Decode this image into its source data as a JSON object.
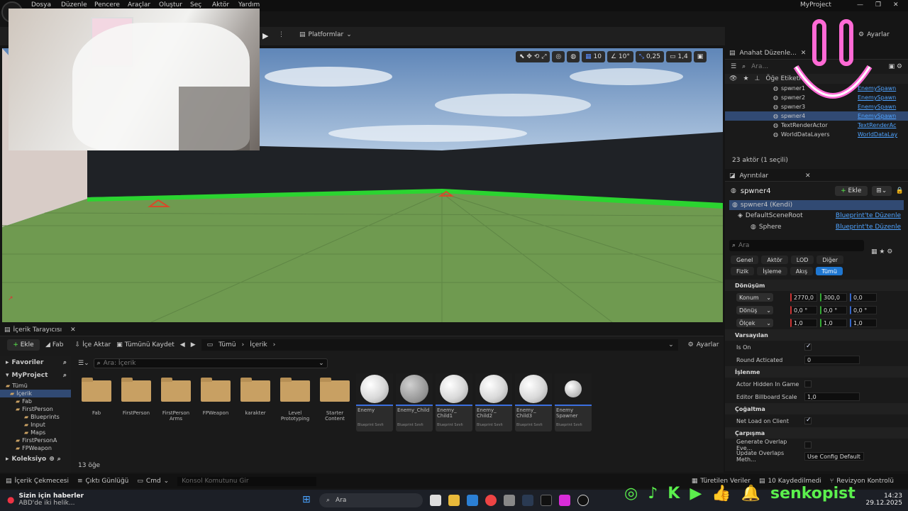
{
  "app": {
    "title": "MyProject"
  },
  "menu": [
    "Dosya",
    "Düzenle",
    "Pencere",
    "Araçlar",
    "Oluştur",
    "Seç",
    "Aktör",
    "Yardım"
  ],
  "toolbar": {
    "platforms": "Platformlar",
    "settings": "Ayarlar"
  },
  "viewport": {
    "grid_snap": "10",
    "rot_snap": "10°",
    "scale_snap": "0,25",
    "cam_speed": "1,4"
  },
  "outliner": {
    "tab": "Anahat Düzenle...",
    "search_placeholder": "Ara...",
    "col_label": "Öğe Etiketi",
    "rows": [
      {
        "name": "spwner1",
        "type": "EnemySpawn"
      },
      {
        "name": "spwner2",
        "type": "EnemySpawn"
      },
      {
        "name": "spwner3",
        "type": "EnemySpawn"
      },
      {
        "name": "spwner4",
        "type": "EnemySpawn"
      },
      {
        "name": "TextRenderActor",
        "type": "TextRenderAc"
      },
      {
        "name": "WorldDataLayers",
        "type": "WorldDataLay"
      }
    ],
    "count": "23 aktör (1 seçili)"
  },
  "details": {
    "tab": "Ayrıntılar",
    "actor": "spwner4",
    "add": "Ekle",
    "self": "spwner4 (Kendi)",
    "root": "DefaultSceneRoot",
    "sphere": "Sphere",
    "edit_bp": "Blueprint'te Düzenle",
    "search_placeholder": "Ara",
    "filters": [
      "Genel",
      "Aktör",
      "LOD",
      "Diğer",
      "Fizik",
      "İşleme",
      "Akış",
      "Tümü"
    ],
    "sec_transform": "Dönüşüm",
    "loc_label": "Konum",
    "rot_label": "Dönüş",
    "scale_label": "Ölçek",
    "loc": [
      "2770,0",
      "300,0",
      "0,0"
    ],
    "rot": [
      "0,0 °",
      "0,0 °",
      "0,0 °"
    ],
    "scale": [
      "1,0",
      "1,0",
      "1,0"
    ],
    "sec_default": "Varsayılan",
    "is_on": "Is On",
    "round": "Round Acticated",
    "round_val": "0",
    "sec_render": "İşlenme",
    "hidden": "Actor Hidden In Game",
    "billboard": "Editor Billboard Scale",
    "billboard_val": "1,0",
    "sec_repl": "Çoğaltma",
    "netload": "Net Load on Client",
    "sec_coll": "Çarpışma",
    "overlap": "Generate Overlap Eve...",
    "update": "Update Overlaps Meth...",
    "update_val": "Use Config Default"
  },
  "content": {
    "tab": "İçerik Tarayıcısı",
    "add": "Ekle",
    "fab": "Fab",
    "import": "İçe Aktar",
    "saveall": "Tümünü Kaydet",
    "crumbs": [
      "Tümü",
      "İçerik"
    ],
    "settings": "Ayarlar",
    "favorites": "Favoriler",
    "project": "MyProject",
    "search_placeholder": "Ara: İçerik",
    "tree": [
      "Tümü",
      "İçerik",
      "Fab",
      "FirstPerson",
      "Blueprints",
      "Input",
      "Maps",
      "FirstPersonA",
      "FPWeapon"
    ],
    "collections": "Koleksiyo",
    "folders": [
      "Fab",
      "FirstPerson",
      "FirstPerson Arms",
      "FPWeapon",
      "karakter",
      "Level Prototyping",
      "Starter Content"
    ],
    "assets": [
      {
        "name": "Enemy",
        "type": "Blueprint Sınıfı"
      },
      {
        "name": "Enemy_Child",
        "type": "Blueprint Sınıfı"
      },
      {
        "name": "Enemy_ Child1",
        "type": "Blueprint Sınıfı"
      },
      {
        "name": "Enemy_ Child2",
        "type": "Blueprint Sınıfı"
      },
      {
        "name": "Enemy_ Child3",
        "type": "Blueprint Sınıfı"
      },
      {
        "name": "Enemy Spawner",
        "type": "Blueprint Sınıfı"
      }
    ],
    "count": "13 öğe"
  },
  "status": {
    "drawer": "İçerik Çekmecesi",
    "log": "Çıktı Günlüğü",
    "cmd": "Cmd",
    "console_placeholder": "Konsol Komutunu Gir",
    "derived": "Türetilen Veriler",
    "unsaved": "10 Kaydedilmedi",
    "revision": "Revizyon Kontrolü"
  },
  "taskbar": {
    "news_title": "Sizin için haberler",
    "news_sub": "ABD'de iki helik...",
    "search": "Ara",
    "time": "14:23",
    "date": "29.12.2025"
  },
  "overlay": {
    "handle": "senkopist"
  },
  "colors": {
    "accent": "#3b6fe0",
    "selected": "#314a73",
    "pink": "#ff6ad5",
    "green": "#5bf04d"
  }
}
